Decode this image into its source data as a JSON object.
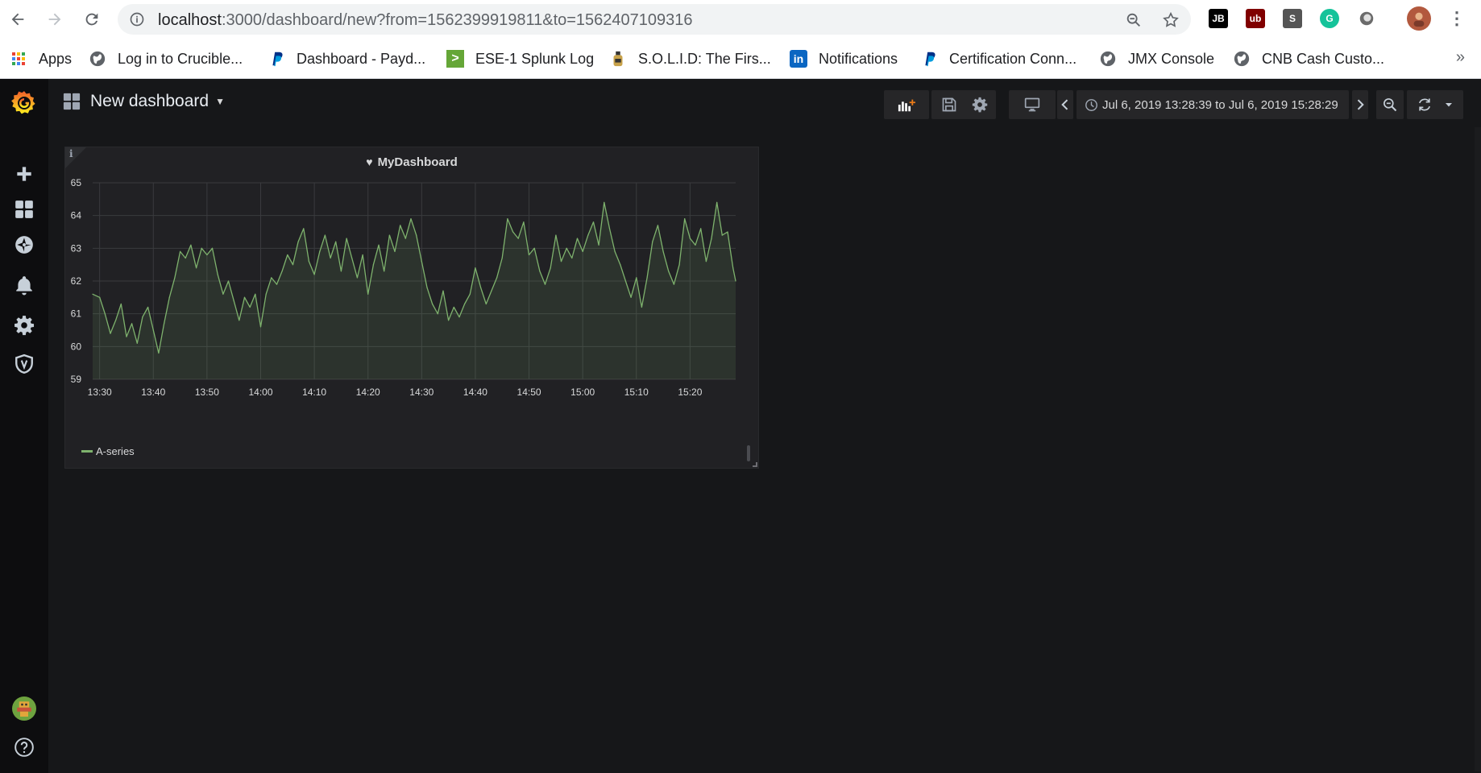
{
  "browser": {
    "url_host": "localhost",
    "url_path": ":3000/dashboard/new?from=1562399919811&to=1562407109316",
    "extensions": [
      {
        "name": "jetbrains-icon",
        "text": "JB",
        "color": "#000000"
      },
      {
        "name": "ublock-icon",
        "text": "ub",
        "color": "#800000"
      },
      {
        "name": "s-extension-icon",
        "text": "S",
        "color": "#555555"
      },
      {
        "name": "grammarly-icon",
        "text": "G",
        "color": "#15c39a"
      },
      {
        "name": "circle-extension-icon",
        "text": "",
        "color": "#888888"
      }
    ],
    "bookmarks": [
      {
        "label": "Apps",
        "icon": "apps-grid-icon"
      },
      {
        "label": "Log in to Crucible...",
        "icon": "globe-icon"
      },
      {
        "label": "Dashboard - Payd...",
        "icon": "paypal-icon"
      },
      {
        "label": "ESE-1 Splunk Log",
        "icon": "splunk-icon"
      },
      {
        "label": "S.O.L.I.D: The Firs...",
        "icon": "bottle-icon"
      },
      {
        "label": "Notifications",
        "icon": "linkedin-icon"
      },
      {
        "label": "Certification Conn...",
        "icon": "paypal-icon"
      },
      {
        "label": "JMX Console",
        "icon": "globe-icon"
      },
      {
        "label": "CNB Cash Custo...",
        "icon": "globe-icon"
      }
    ],
    "more": "»"
  },
  "grafana": {
    "dashboard_title": "New dashboard",
    "time_range": "Jul 6, 2019 13:28:39 to Jul 6, 2019 15:28:29",
    "panel": {
      "title": "MyDashboard",
      "info": "i",
      "legend": "A-series"
    }
  },
  "chart_data": {
    "type": "line",
    "title": "MyDashboard",
    "xlabel": "",
    "ylabel": "",
    "ylim": [
      59,
      65
    ],
    "yticks": [
      59,
      60,
      61,
      62,
      63,
      64,
      65
    ],
    "xticks": [
      "13:30",
      "13:40",
      "13:50",
      "14:00",
      "14:10",
      "14:20",
      "14:30",
      "14:40",
      "14:50",
      "15:00",
      "15:10",
      "15:20"
    ],
    "grid": true,
    "legend_placement": "bottom-left",
    "series": [
      {
        "name": "A-series",
        "color": "#7eb26d",
        "x_minutes_from_1330": [
          -1.3,
          0,
          1,
          2,
          3,
          4,
          5,
          6,
          7,
          8,
          9,
          10,
          11,
          12,
          13,
          14,
          15,
          16,
          17,
          18,
          19,
          20,
          21,
          22,
          23,
          24,
          25,
          26,
          27,
          28,
          29,
          30,
          31,
          32,
          33,
          34,
          35,
          36,
          37,
          38,
          39,
          40,
          41,
          42,
          43,
          44,
          45,
          46,
          47,
          48,
          49,
          50,
          51,
          52,
          53,
          54,
          55,
          56,
          57,
          58,
          59,
          60,
          61,
          62,
          63,
          64,
          65,
          66,
          67,
          68,
          69,
          70,
          71,
          72,
          73,
          74,
          75,
          76,
          77,
          78,
          79,
          80,
          81,
          82,
          83,
          84,
          85,
          86,
          87,
          88,
          89,
          90,
          91,
          92,
          93,
          94,
          95,
          96,
          97,
          98,
          99,
          100,
          101,
          102,
          103,
          104,
          105,
          106,
          107,
          108,
          109,
          110,
          111,
          112,
          113,
          114,
          115,
          116,
          117,
          118,
          118.5
        ],
        "values": [
          61.6,
          61.5,
          61.0,
          60.4,
          60.8,
          61.3,
          60.3,
          60.7,
          60.1,
          60.9,
          61.2,
          60.5,
          59.8,
          60.7,
          61.5,
          62.1,
          62.9,
          62.7,
          63.1,
          62.4,
          63.0,
          62.8,
          63.0,
          62.2,
          61.6,
          62.0,
          61.4,
          60.8,
          61.5,
          61.2,
          61.6,
          60.6,
          61.6,
          62.1,
          61.9,
          62.3,
          62.8,
          62.5,
          63.2,
          63.6,
          62.6,
          62.2,
          62.9,
          63.4,
          62.7,
          63.2,
          62.3,
          63.3,
          62.7,
          62.1,
          62.8,
          61.6,
          62.5,
          63.1,
          62.3,
          63.4,
          62.9,
          63.7,
          63.3,
          63.9,
          63.4,
          62.6,
          61.8,
          61.3,
          61.0,
          61.7,
          60.8,
          61.2,
          60.9,
          61.3,
          61.6,
          62.4,
          61.8,
          61.3,
          61.7,
          62.1,
          62.7,
          63.9,
          63.5,
          63.3,
          63.8,
          62.8,
          63.0,
          62.3,
          61.9,
          62.4,
          63.4,
          62.6,
          63.0,
          62.7,
          63.3,
          62.9,
          63.4,
          63.8,
          63.1,
          64.4,
          63.6,
          62.9,
          62.5,
          62.0,
          61.5,
          62.1,
          61.2,
          62.1,
          63.2,
          63.7,
          62.9,
          62.3,
          61.9,
          62.5,
          63.9,
          63.3,
          63.1,
          63.6,
          62.6,
          63.3,
          64.4,
          63.4,
          63.5,
          62.4,
          62.0
        ]
      }
    ]
  }
}
